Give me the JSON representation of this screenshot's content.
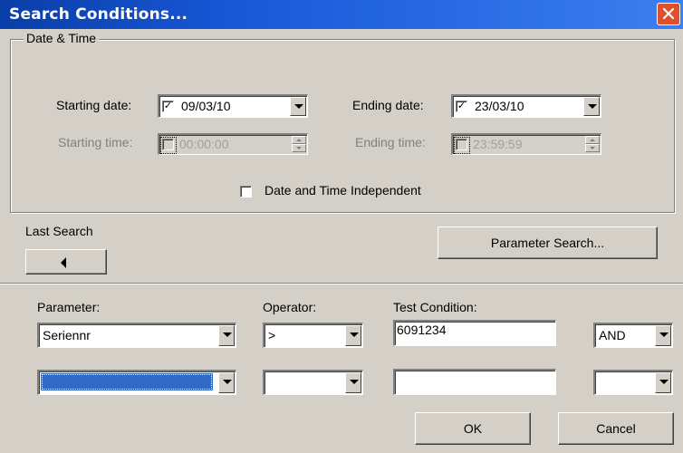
{
  "window": {
    "title": "Search Conditions..."
  },
  "date_time_group": {
    "legend": "Date & Time",
    "starting_date_label": "Starting date:",
    "starting_date_checked": true,
    "starting_date_value": "09/03/10",
    "ending_date_label": "Ending date:",
    "ending_date_checked": true,
    "ending_date_value": "23/03/10",
    "starting_time_label": "Starting time:",
    "starting_time_checked": false,
    "starting_time_value": "00:00:00",
    "ending_time_label": "Ending time:",
    "ending_time_checked": false,
    "ending_time_value": "23:59:59",
    "independent_label": "Date and Time Independent",
    "independent_checked": false
  },
  "last_search": {
    "label": "Last Search"
  },
  "parameter_search_button": "Parameter Search...",
  "conditions": {
    "parameter_header": "Parameter:",
    "operator_header": "Operator:",
    "test_condition_header": "Test Condition:",
    "rows": [
      {
        "parameter": "Seriennr",
        "operator": ">",
        "test_condition": "6091234",
        "logic": "AND"
      },
      {
        "parameter": "",
        "operator": "",
        "test_condition": "",
        "logic": ""
      }
    ]
  },
  "buttons": {
    "ok": "OK",
    "cancel": "Cancel"
  },
  "colors": {
    "title_start": "#0a3ea8",
    "title_end": "#3c7ff0",
    "selection": "#316ac5",
    "face": "#d4d0c8"
  }
}
